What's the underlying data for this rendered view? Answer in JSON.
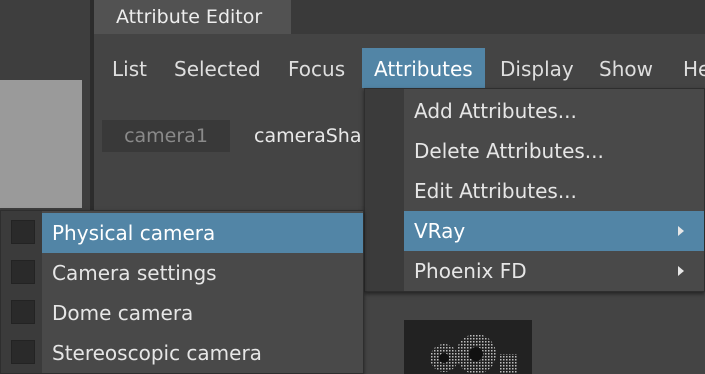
{
  "window": {
    "title": "Attribute Editor"
  },
  "menubar": {
    "items": [
      "List",
      "Selected",
      "Focus",
      "Attributes",
      "Display",
      "Show",
      "He"
    ],
    "active": "Attributes"
  },
  "node_tabs": {
    "inactive": "camera1",
    "current": "cameraSha"
  },
  "attributes_menu": {
    "items": [
      {
        "label": "Add Attributes...",
        "submenu": false
      },
      {
        "label": "Delete Attributes...",
        "submenu": false
      },
      {
        "label": "Edit Attributes...",
        "submenu": false
      },
      {
        "label": "VRay",
        "submenu": true,
        "highlighted": true
      },
      {
        "label": "Phoenix FD",
        "submenu": true
      }
    ]
  },
  "vray_submenu": {
    "items": [
      {
        "label": "Physical camera",
        "highlighted": true,
        "checked": false
      },
      {
        "label": "Camera settings",
        "checked": false
      },
      {
        "label": "Dome camera",
        "checked": false
      },
      {
        "label": "Stereoscopic camera",
        "checked": false
      }
    ]
  },
  "colors": {
    "accent": "#5285a6",
    "panel": "#444444",
    "menu": "#494949"
  }
}
